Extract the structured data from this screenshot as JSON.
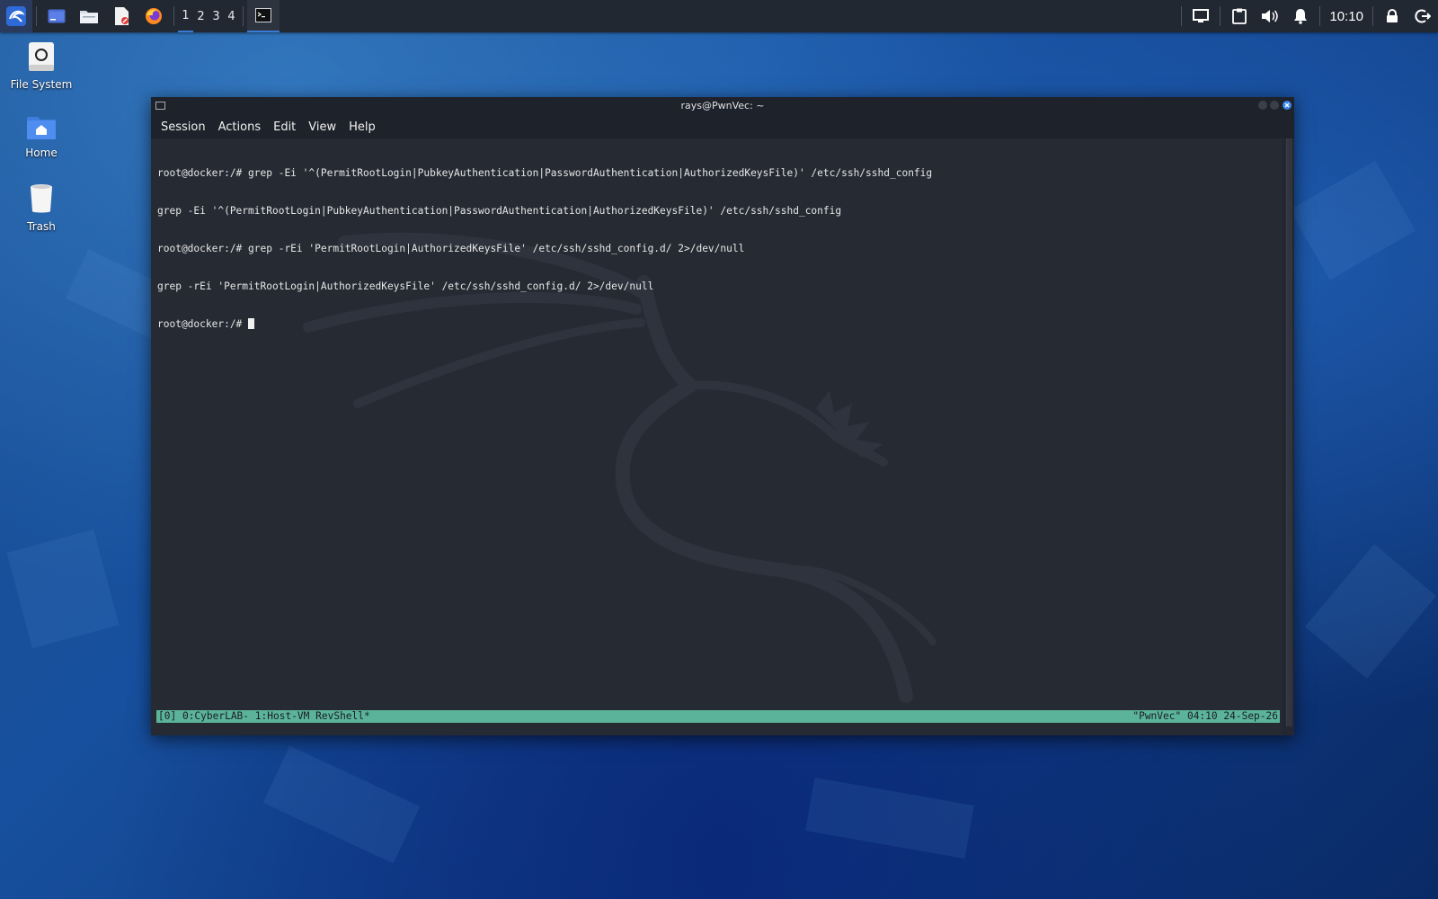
{
  "panel": {
    "workspaces": [
      "1",
      "2",
      "3",
      "4"
    ],
    "active_workspace": "1",
    "clock": "10:10",
    "launchers": [
      "kali-menu-icon",
      "terminal-icon",
      "files-icon",
      "text-editor-icon",
      "firefox-icon"
    ]
  },
  "desktop": {
    "icons": [
      {
        "label": "File System",
        "icon": "drive-icon"
      },
      {
        "label": "Home",
        "icon": "home-folder-icon"
      },
      {
        "label": "Trash",
        "icon": "trash-icon"
      }
    ]
  },
  "window": {
    "title": "rays@PwnVec: ~",
    "menu": [
      "Session",
      "Actions",
      "Edit",
      "View",
      "Help"
    ]
  },
  "terminal": {
    "lines": [
      "root@docker:/# grep -Ei '^(PermitRootLogin|PubkeyAuthentication|PasswordAuthentication|AuthorizedKeysFile)' /etc/ssh/sshd_config",
      "grep -Ei '^(PermitRootLogin|PubkeyAuthentication|PasswordAuthentication|AuthorizedKeysFile)' /etc/ssh/sshd_config",
      "root@docker:/# grep -rEi 'PermitRootLogin|AuthorizedKeysFile' /etc/ssh/sshd_config.d/ 2>/dev/null",
      "grep -rEi 'PermitRootLogin|AuthorizedKeysFile' /etc/ssh/sshd_config.d/ 2>/dev/null"
    ],
    "prompt": "root@docker:/# ",
    "status_left": "[0] 0:CyberLAB- 1:Host-VM RevShell*",
    "status_right": "\"PwnVec\" 04:10 24-Sep-26"
  },
  "colors": {
    "status_bar": "#5bb49a",
    "terminal_bg": "#262a33",
    "accent": "#3a7bd5"
  }
}
